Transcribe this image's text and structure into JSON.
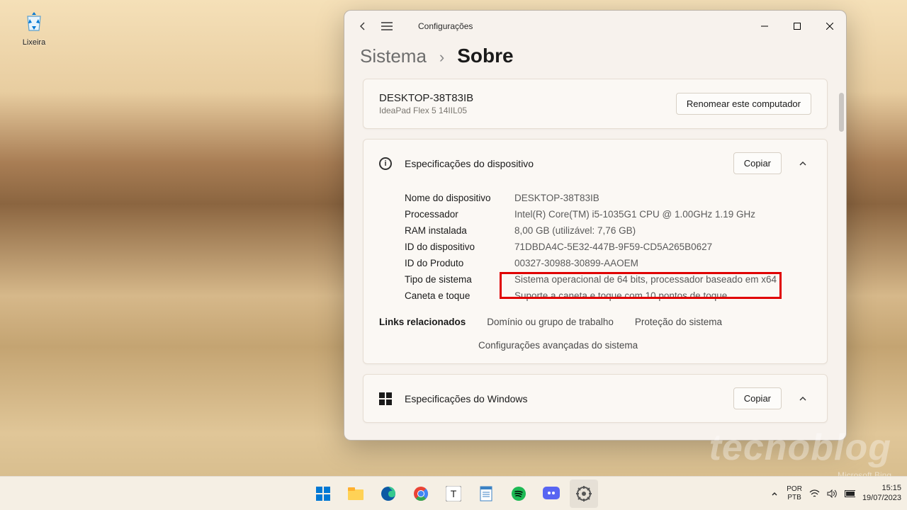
{
  "desktop": {
    "recycle_label": "Lixeira"
  },
  "window": {
    "back": "←",
    "menu": "≡",
    "title": "Configurações",
    "breadcrumb1": "Sistema",
    "sep": "›",
    "breadcrumb2": "Sobre",
    "device_name": "DESKTOP-38T83IB",
    "device_model": "IdeaPad Flex 5 14IIL05",
    "rename_btn": "Renomear este computador",
    "devspec_title": "Especificações do dispositivo",
    "copy_btn": "Copiar",
    "specs": {
      "k1": "Nome do dispositivo",
      "v1": "DESKTOP-38T83IB",
      "k2": "Processador",
      "v2": "Intel(R) Core(TM) i5-1035G1 CPU @ 1.00GHz   1.19 GHz",
      "k3": "RAM instalada",
      "v3": "8,00 GB (utilizável: 7,76 GB)",
      "k4": "ID do dispositivo",
      "v4": "71DBDA4C-5E32-447B-9F59-CD5A265B0627",
      "k5": "ID do Produto",
      "v5": "00327-30988-30899-AAOEM",
      "k6": "Tipo de sistema",
      "v6": "Sistema operacional de 64 bits, processador baseado em x64",
      "k7": "Caneta e toque",
      "v7": "Suporte a caneta e toque com 10 pontos de toque"
    },
    "related_label": "Links relacionados",
    "rel1": "Domínio ou grupo de trabalho",
    "rel2": "Proteção do sistema",
    "rel3": "Configurações avançadas do sistema",
    "winspec_title": "Especificações do Windows"
  },
  "watermark": "tecnoblog",
  "bing_wm": "Microsoft Bing",
  "tray": {
    "lang1": "POR",
    "lang2": "PTB",
    "time": "15:15",
    "date": "19/07/2023"
  }
}
